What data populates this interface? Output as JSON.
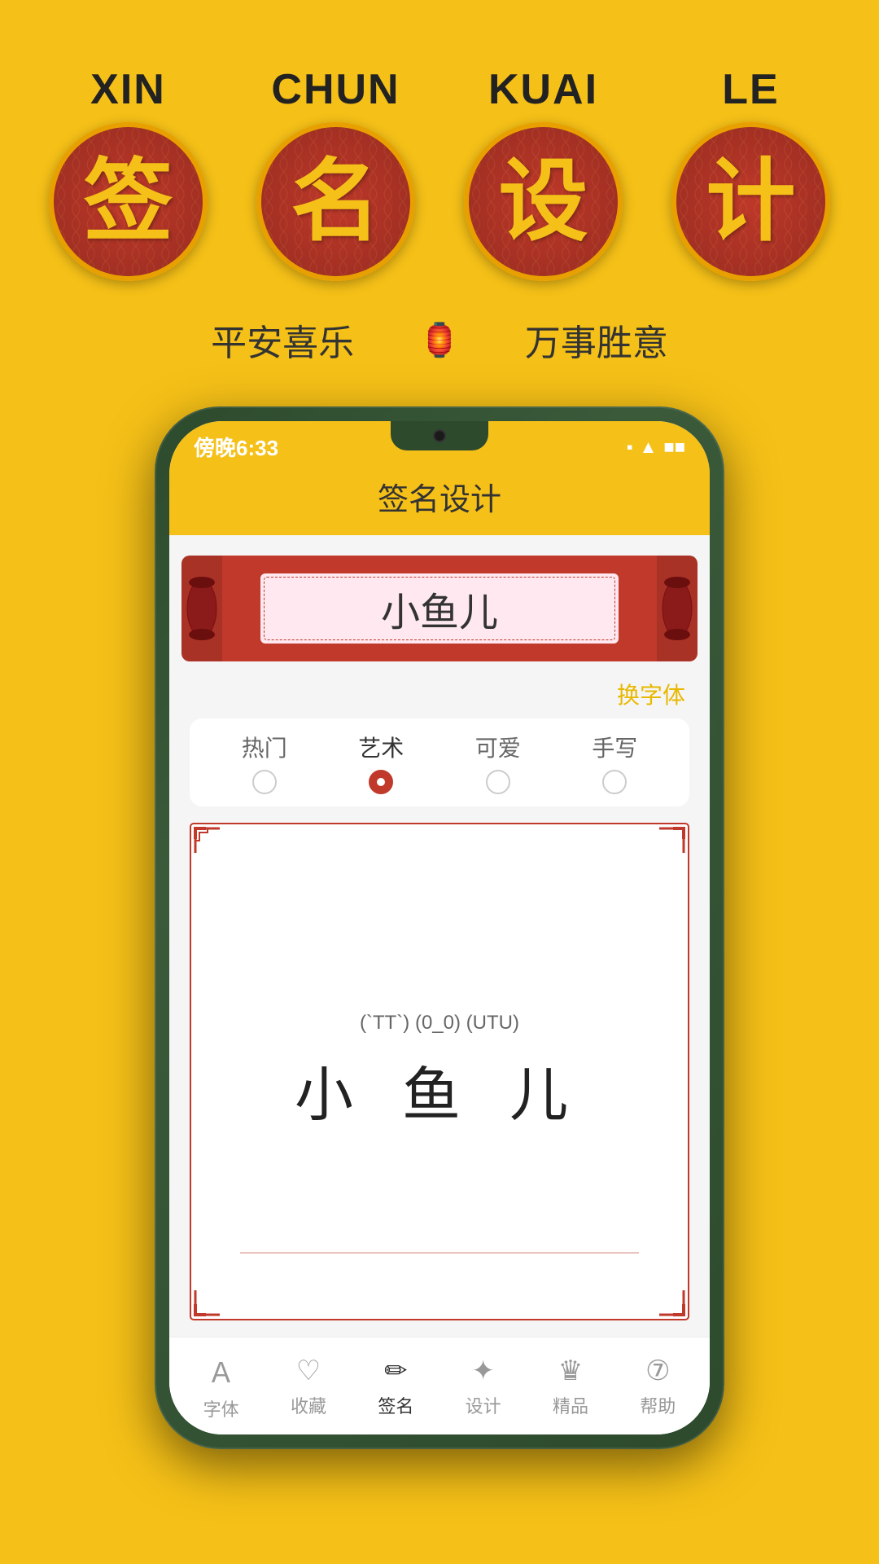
{
  "background_color": "#F5C017",
  "top": {
    "chars": [
      {
        "pinyin": "XIN",
        "char": "签"
      },
      {
        "pinyin": "CHUN",
        "char": "名"
      },
      {
        "pinyin": "KUAI",
        "char": "设"
      },
      {
        "pinyin": "LE",
        "char": "计"
      }
    ],
    "subtitle_left": "平安喜乐",
    "subtitle_right": "万事胜意"
  },
  "phone": {
    "status_time": "傍晚6:33",
    "app_title": "签名设计",
    "scroll_name": "小鱼儿",
    "change_font_label": "换字体",
    "font_tabs": [
      {
        "label": "热门",
        "active": false
      },
      {
        "label": "艺术",
        "active": true
      },
      {
        "label": "可爱",
        "active": false
      },
      {
        "label": "手写",
        "active": false
      }
    ],
    "sig_emoticons": "(`TT`) (0_0) (UTU)",
    "sig_name": "小 鱼 儿",
    "bottom_nav": [
      {
        "icon": "A",
        "label": "字体",
        "active": false
      },
      {
        "icon": "♡",
        "label": "收藏",
        "active": false
      },
      {
        "icon": "✏",
        "label": "签名",
        "active": true
      },
      {
        "icon": "✦",
        "label": "设计",
        "active": false
      },
      {
        "icon": "♛",
        "label": "精品",
        "active": false
      },
      {
        "icon": "?",
        "label": "帮助",
        "active": false
      }
    ]
  }
}
